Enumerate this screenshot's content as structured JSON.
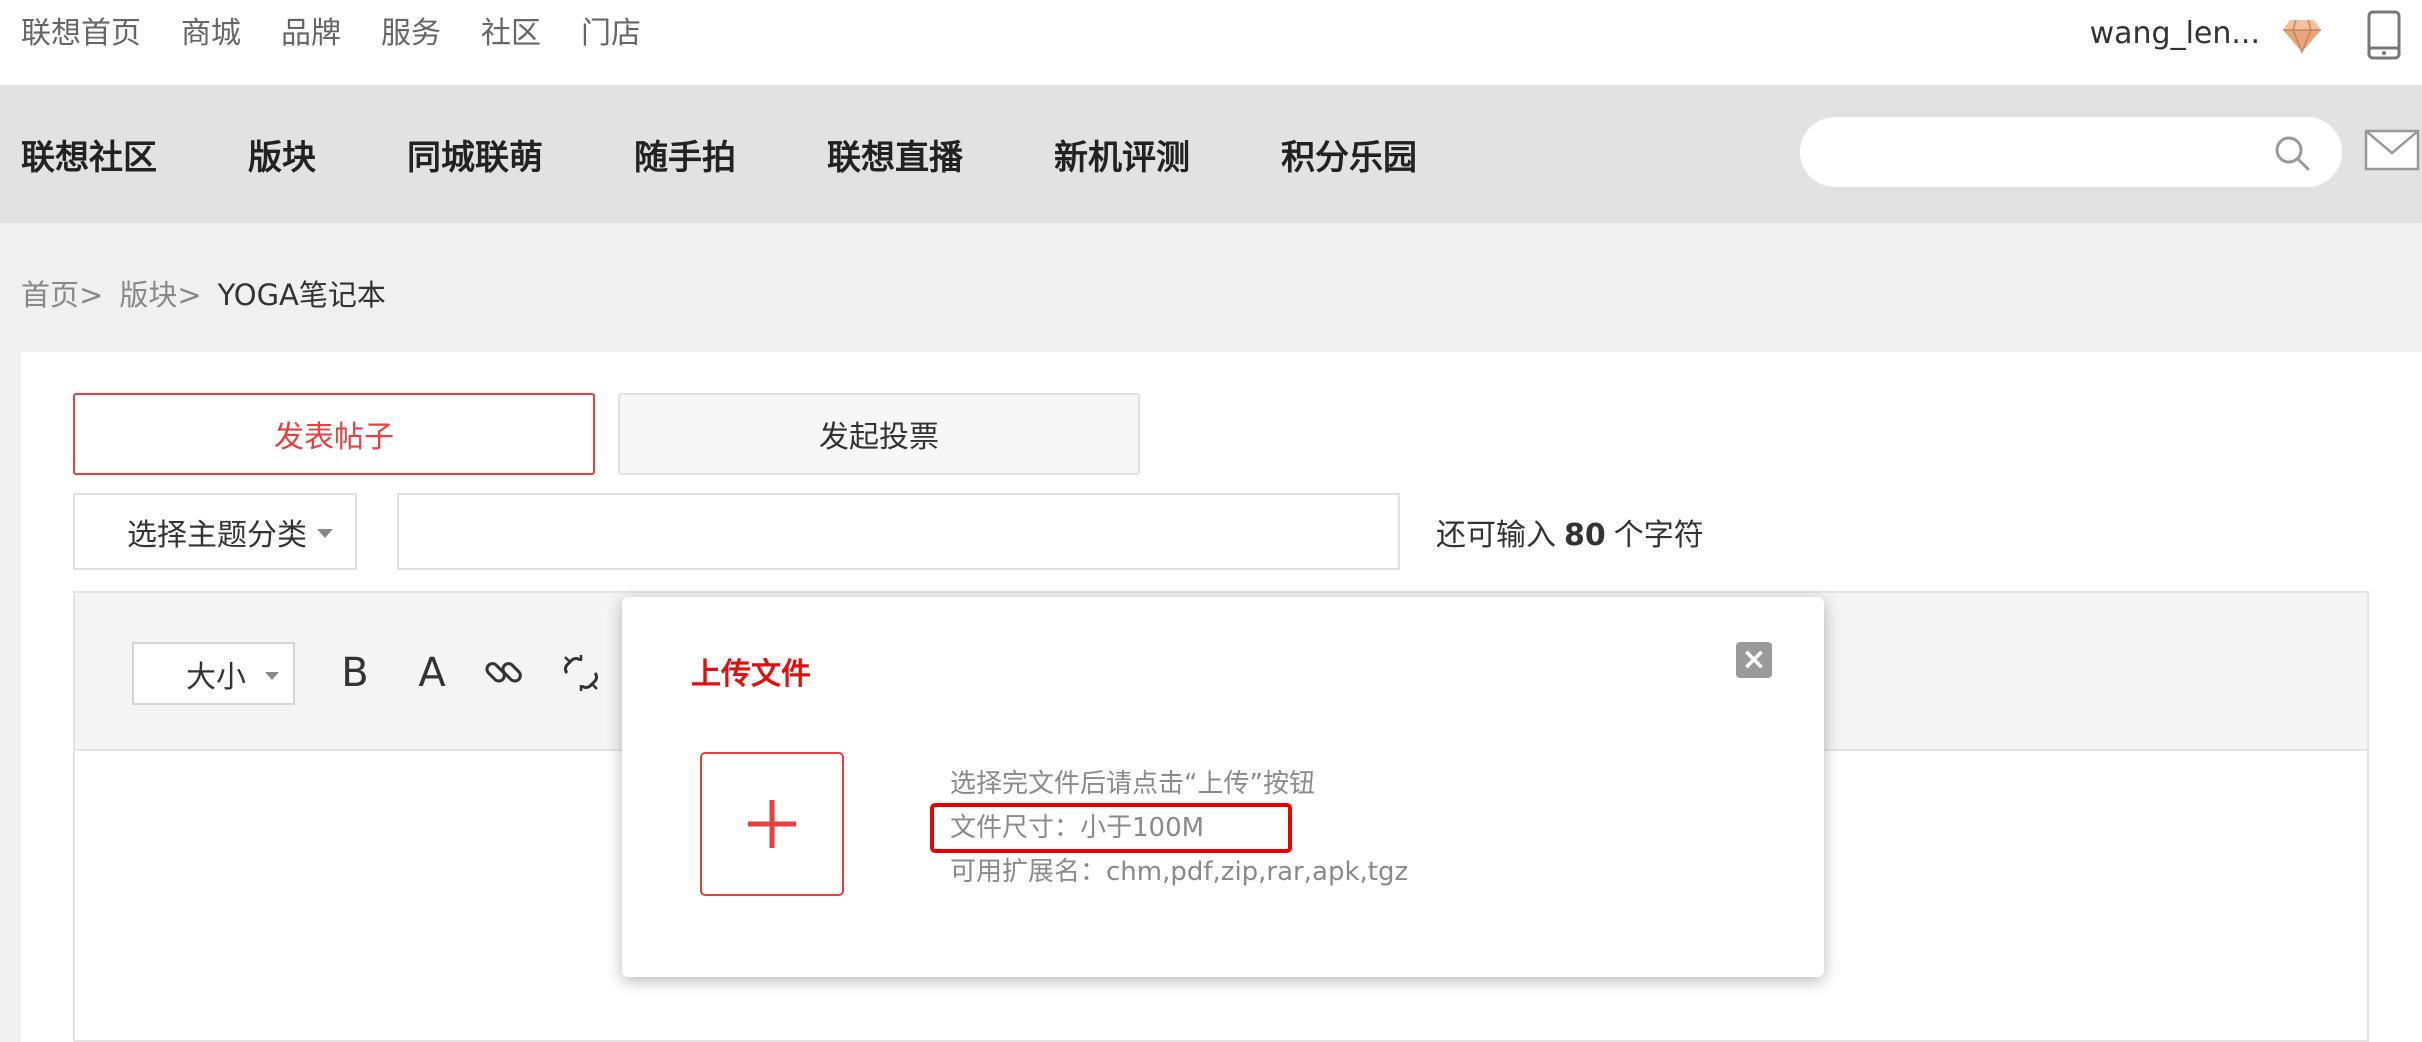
{
  "topbar": {
    "nav": [
      "联想首页",
      "商城",
      "品牌",
      "服务",
      "社区",
      "门店"
    ],
    "username": "wang_len..."
  },
  "mainnav": {
    "items": [
      "联想社区",
      "版块",
      "同城联萌",
      "随手拍",
      "联想直播",
      "新机评测",
      "积分乐园"
    ],
    "search_placeholder": ""
  },
  "breadcrumb": {
    "home": "首页>",
    "section": "版块>",
    "current": "YOGA笔记本"
  },
  "compose": {
    "tab_post": "发表帖子",
    "tab_vote": "发起投票",
    "topic_select": "选择主题分类",
    "title_value": "",
    "counter_prefix": "还可输入",
    "counter_value": "80",
    "counter_suffix": "个字符"
  },
  "toolbar": {
    "size_label": "大小",
    "bold": "B",
    "font_color": "A"
  },
  "upload_modal": {
    "title": "上传文件",
    "close": "×",
    "hint": "选择完文件后请点击“上传”按钮",
    "size_limit": "文件尺寸：小于100M",
    "extensions": "可用扩展名：chm,pdf,zip,rar,apk,tgz"
  },
  "colors": {
    "accent": "#e84040",
    "modal_title": "#e01010",
    "highlight": "#ee0000"
  }
}
